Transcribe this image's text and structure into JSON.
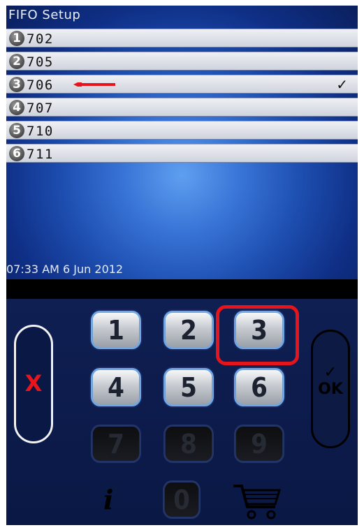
{
  "screen": {
    "title": "FIFO Setup",
    "items": [
      {
        "num": "1",
        "code": "702",
        "checked": false
      },
      {
        "num": "2",
        "code": "705",
        "checked": false
      },
      {
        "num": "3",
        "code": "706",
        "checked": true
      },
      {
        "num": "4",
        "code": "707",
        "checked": false
      },
      {
        "num": "5",
        "code": "710",
        "checked": false
      },
      {
        "num": "6",
        "code": "711",
        "checked": false
      }
    ],
    "check_mark": "✓",
    "datetime": "07:33 AM 6 Jun 2012"
  },
  "keypad": {
    "keys": [
      "1",
      "2",
      "3",
      "4",
      "5",
      "6",
      "7",
      "8",
      "9",
      "0"
    ],
    "cancel_label": "X",
    "ok_label": "OK",
    "ok_tick": "✓",
    "info_label": "i",
    "cart_icon": "cart-icon"
  },
  "colors": {
    "annotation_red": "#e8141b",
    "cancel_red": "#e8151b"
  }
}
